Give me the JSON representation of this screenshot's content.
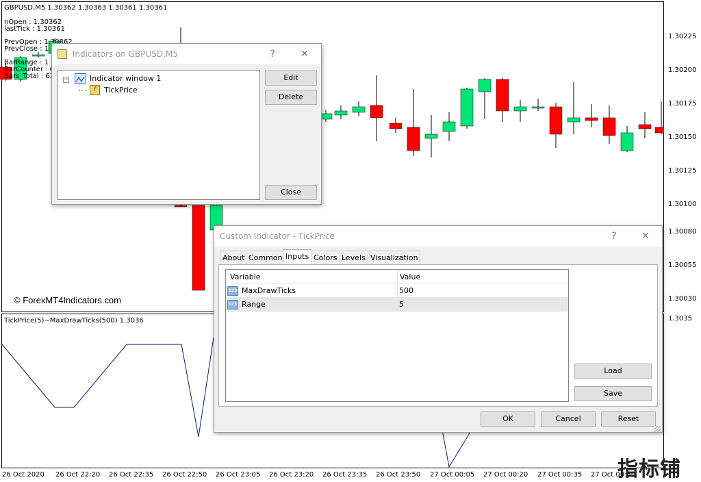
{
  "chart": {
    "symbol_line": "GBPUSD,M5  1.30362 1.30363 1.30361 1.30361",
    "info_lines": [
      "nOpen : 1.30362",
      "lastTick : 1.30361",
      "PrevOpen : 1.30862",
      "PrevClose : 1.3",
      "BarRange : 1",
      "BarCounter : 63",
      "Bars_Total : 63"
    ],
    "watermark": "© ForexMT4Indicators.com",
    "indicator_label": "TickPrice(5)~MaxDrawTicks(500) 1.3036",
    "price_labels": [
      "1.30225",
      "1.30200",
      "1.30175",
      "1.30150",
      "1.30125",
      "1.30100",
      "1.30080",
      "1.30055",
      "1.30030",
      "1.3035"
    ],
    "time_labels": [
      "26 Oct 2020",
      "26 Oct 22:20",
      "26 Oct 22:35",
      "26 Oct 22:50",
      "26 Oct 23:05",
      "26 Oct 23:20",
      "26 Oct 23:35",
      "26 Oct 23:50",
      "27 Oct 00:05",
      "27 Oct 00:20",
      "27 Oct 00:35",
      "27 Oct 00:50"
    ],
    "bull_color": "#00e676",
    "bear_color": "#ff0000",
    "corner_watermark": "指标铺"
  },
  "indicators_dialog": {
    "title": "Indicators on GBPUSD,M5",
    "help": "?",
    "close_x": "✕",
    "tree_window": "Indicator window 1",
    "tree_item": "TickPrice",
    "edit": "Edit",
    "delete": "Delete",
    "close": "Close"
  },
  "custom_dialog": {
    "title": "Custom Indicator - TickPrice",
    "help": "?",
    "close_x": "✕",
    "tabs": [
      "About",
      "Common",
      "Inputs",
      "Colors",
      "Levels",
      "Visualization"
    ],
    "active_tab": "Inputs",
    "col_variable": "Variable",
    "col_value": "Value",
    "rows": [
      {
        "variable": "MaxDrawTicks",
        "value": "500"
      },
      {
        "variable": "Range",
        "value": "5"
      }
    ],
    "load": "Load",
    "save": "Save",
    "ok": "OK",
    "cancel": "Cancel",
    "reset": "Reset"
  }
}
